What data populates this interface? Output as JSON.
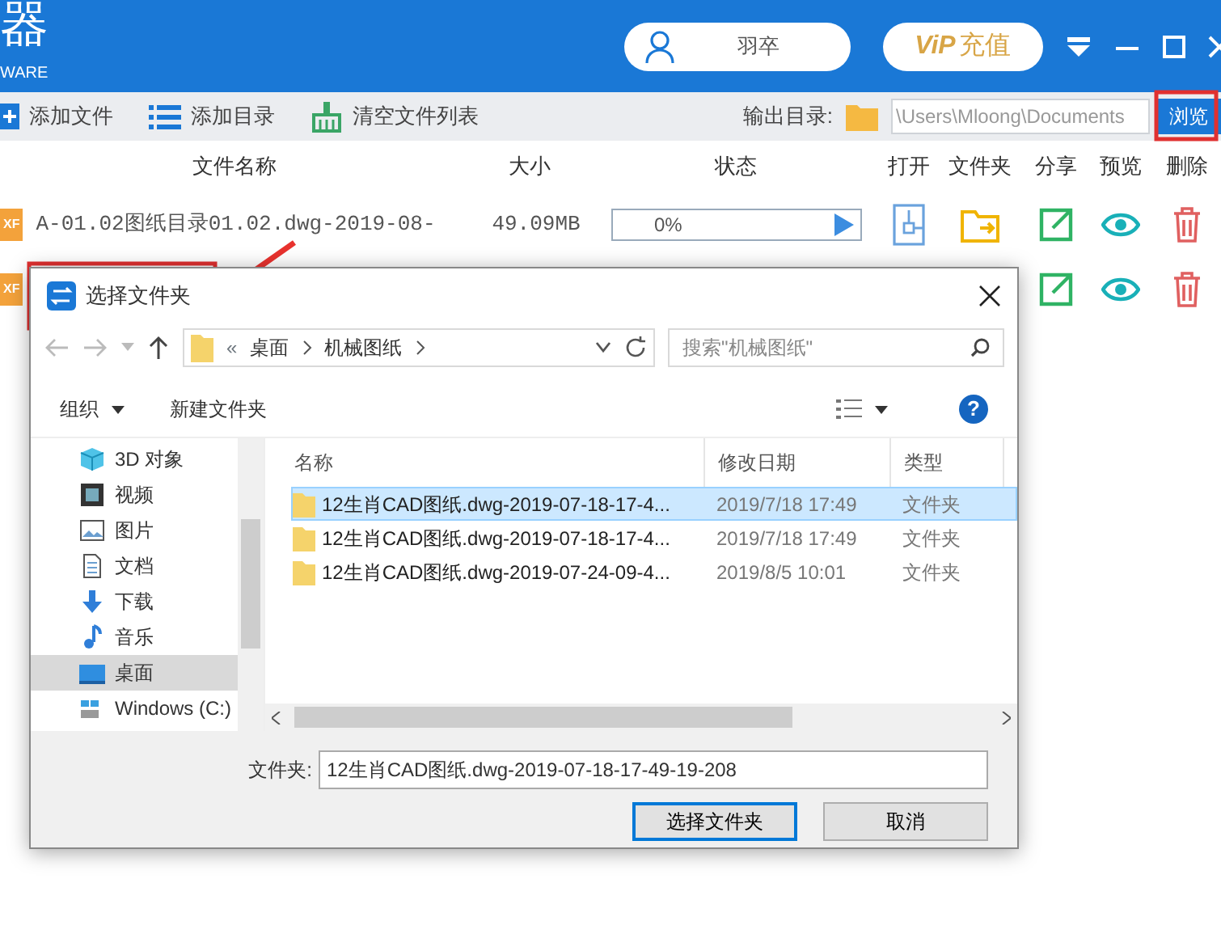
{
  "app": {
    "title_fragment": "器",
    "subtitle_fragment": "WARE",
    "user": "羽卒",
    "vip": {
      "logo": "ViP",
      "label": "充值"
    }
  },
  "toolbar": {
    "actions": [
      {
        "kind": "file",
        "label": "添加文件"
      },
      {
        "kind": "list",
        "label": "添加目录"
      },
      {
        "kind": "broom",
        "label": "清空文件列表"
      }
    ],
    "output_label": "输出目录:",
    "output_path": "\\Users\\Mloong\\Documents",
    "browse": "浏览"
  },
  "columns": [
    "文件名称",
    "大小",
    "状态",
    "打开",
    "文件夹",
    "分享",
    "预览",
    "删除"
  ],
  "files": [
    {
      "badge": "XF",
      "name": "A-01.02图纸目录01.02.dwg-2019-08-",
      "size": "49.09MB",
      "status": "0%",
      "level": 0
    },
    {
      "badge": "XF"
    }
  ],
  "dialog": {
    "title": "选择文件夹",
    "path": [
      "桌面",
      "机械图纸"
    ],
    "path_prefix": "«",
    "search_placeholder": "搜索\"机械图纸\"",
    "commands": [
      "组织",
      "新建文件夹"
    ],
    "help": "?",
    "tree": [
      {
        "kind": "cube",
        "label": "3D 对象",
        "selected": false
      },
      {
        "kind": "film",
        "label": "视频",
        "selected": false
      },
      {
        "kind": "picture",
        "label": "图片",
        "selected": false
      },
      {
        "kind": "doc",
        "label": "文档",
        "selected": false
      },
      {
        "kind": "download",
        "label": "下载",
        "selected": false
      },
      {
        "kind": "music",
        "label": "音乐",
        "selected": false
      },
      {
        "kind": "desktop",
        "label": "桌面",
        "selected": true
      },
      {
        "kind": "drive",
        "label": "Windows (C:)",
        "selected": false
      }
    ],
    "list_columns": [
      "名称",
      "修改日期",
      "类型"
    ],
    "rows": [
      {
        "name": "12生肖CAD图纸.dwg-2019-07-18-17-4...",
        "date": "2019/7/18 17:49",
        "type": "文件夹",
        "selected": true
      },
      {
        "name": "12生肖CAD图纸.dwg-2019-07-18-17-4...",
        "date": "2019/7/18 17:49",
        "type": "文件夹",
        "selected": false
      },
      {
        "name": "12生肖CAD图纸.dwg-2019-07-24-09-4...",
        "date": "2019/8/5 10:01",
        "type": "文件夹",
        "selected": false
      }
    ],
    "folder_label": "文件夹:",
    "folder_value": "12生肖CAD图纸.dwg-2019-07-18-17-49-19-208",
    "buttons": [
      {
        "kind": "primary",
        "label": "选择文件夹"
      },
      {
        "kind": "secondary",
        "label": "取消"
      }
    ]
  }
}
